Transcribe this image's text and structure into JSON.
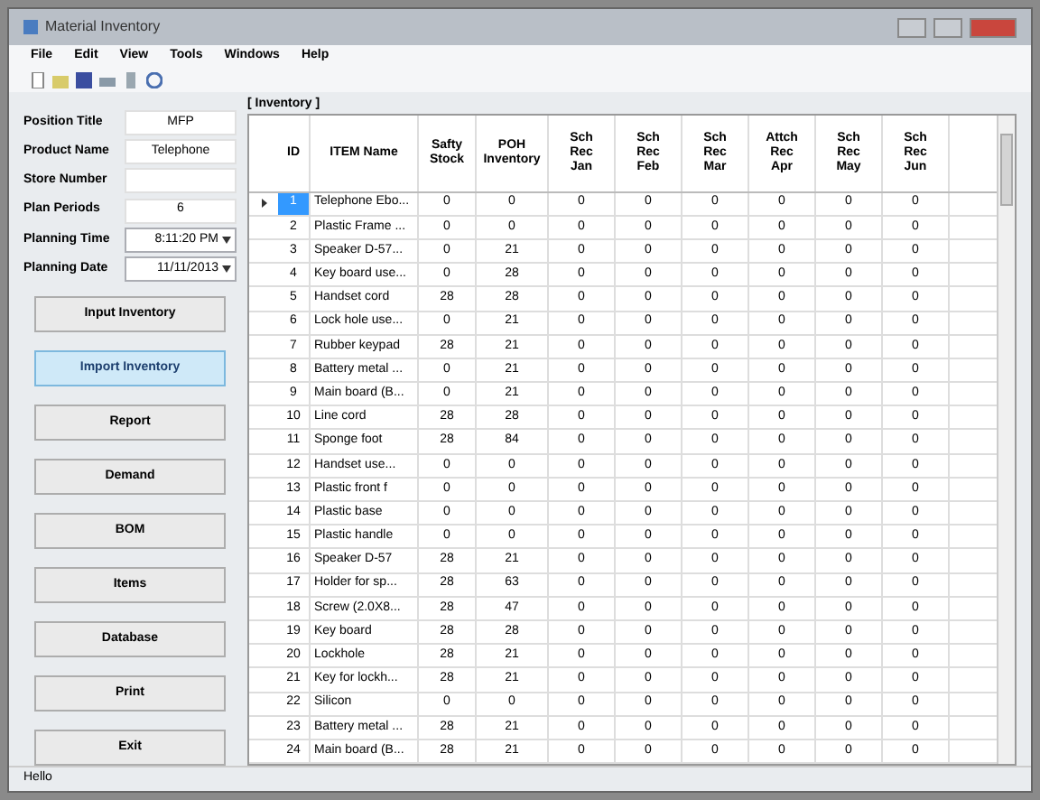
{
  "window": {
    "title": "Material Inventory"
  },
  "menu": [
    "File",
    "Edit",
    "View",
    "Tools",
    "Windows",
    "Help"
  ],
  "form": {
    "fields": [
      {
        "label": "Position Title",
        "value": "MFP",
        "kind": "text"
      },
      {
        "label": "Product Name",
        "value": "Telephone",
        "kind": "text"
      },
      {
        "label": "Store Number",
        "kind": "text"
      },
      {
        "label": "Plan Periods",
        "value": "6",
        "kind": "text"
      },
      {
        "label": "Planning Time",
        "value": "8:11:20 PM",
        "kind": "dropdown"
      },
      {
        "label": "Planning Date",
        "value": "11/11/2013",
        "kind": "dropdown"
      }
    ],
    "buttons": [
      {
        "label": "Input Inventory",
        "selected": false
      },
      {
        "label": "Import Inventory",
        "selected": true
      },
      {
        "label": "Report",
        "selected": false
      },
      {
        "label": "Demand",
        "selected": false
      },
      {
        "label": "BOM",
        "selected": false
      },
      {
        "label": "Items",
        "selected": false
      },
      {
        "label": "Database",
        "selected": false
      },
      {
        "label": "Print",
        "selected": false
      },
      {
        "label": "Exit",
        "selected": false
      }
    ]
  },
  "group_title": "[ Inventory ]",
  "table": {
    "columns": [
      "ID",
      "ITEM Name",
      "Safty Stock",
      "POH Inventory",
      "Sch Rec Jan",
      "Sch Rec Feb",
      "Sch Rec Mar",
      "Attch Rec Apr",
      "Sch Rec May",
      "Sch Rec Jun"
    ],
    "rows": [
      {
        "selected": true,
        "cells": [
          "1",
          "Telephone Ebo...",
          "0",
          "0",
          "0",
          "0",
          "0",
          "0",
          "0",
          "0"
        ]
      },
      {
        "selected": false,
        "cells": [
          "2",
          "Plastic Frame ...",
          "0",
          "0",
          "0",
          "0",
          "0",
          "0",
          "0",
          "0"
        ]
      },
      {
        "selected": false,
        "cells": [
          "3",
          "Speaker D-57...",
          "0",
          "21",
          "0",
          "0",
          "0",
          "0",
          "0",
          "0"
        ]
      },
      {
        "selected": false,
        "cells": [
          "4",
          "Key board use...",
          "0",
          "28",
          "0",
          "0",
          "0",
          "0",
          "0",
          "0"
        ]
      },
      {
        "selected": false,
        "cells": [
          "5",
          "Handset cord",
          "28",
          "28",
          "0",
          "0",
          "0",
          "0",
          "0",
          "0"
        ]
      },
      {
        "selected": false,
        "cells": [
          "6",
          "Lock hole use...",
          "0",
          "21",
          "0",
          "0",
          "0",
          "0",
          "0",
          "0"
        ]
      },
      {
        "selected": false,
        "cells": [
          "7",
          "Rubber keypad",
          "28",
          "21",
          "0",
          "0",
          "0",
          "0",
          "0",
          "0"
        ]
      },
      {
        "selected": false,
        "cells": [
          "8",
          "Battery metal ...",
          "0",
          "21",
          "0",
          "0",
          "0",
          "0",
          "0",
          "0"
        ]
      },
      {
        "selected": false,
        "cells": [
          "9",
          "Main board (B...",
          "0",
          "21",
          "0",
          "0",
          "0",
          "0",
          "0",
          "0"
        ]
      },
      {
        "selected": false,
        "cells": [
          "10",
          "Line cord",
          "28",
          "28",
          "0",
          "0",
          "0",
          "0",
          "0",
          "0"
        ]
      },
      {
        "selected": false,
        "cells": [
          "11",
          "Sponge foot",
          "28",
          "84",
          "0",
          "0",
          "0",
          "0",
          "0",
          "0"
        ]
      },
      {
        "selected": false,
        "cells": [
          "12",
          "Handset use...",
          "0",
          "0",
          "0",
          "0",
          "0",
          "0",
          "0",
          "0"
        ]
      },
      {
        "selected": false,
        "cells": [
          "13",
          "Plastic front f",
          "0",
          "0",
          "0",
          "0",
          "0",
          "0",
          "0",
          "0"
        ]
      },
      {
        "selected": false,
        "cells": [
          "14",
          "Plastic base",
          "0",
          "0",
          "0",
          "0",
          "0",
          "0",
          "0",
          "0"
        ]
      },
      {
        "selected": false,
        "cells": [
          "15",
          "Plastic handle",
          "0",
          "0",
          "0",
          "0",
          "0",
          "0",
          "0",
          "0"
        ]
      },
      {
        "selected": false,
        "cells": [
          "16",
          "Speaker D-57",
          "28",
          "21",
          "0",
          "0",
          "0",
          "0",
          "0",
          "0"
        ]
      },
      {
        "selected": false,
        "cells": [
          "17",
          "Holder for sp...",
          "28",
          "63",
          "0",
          "0",
          "0",
          "0",
          "0",
          "0"
        ]
      },
      {
        "selected": false,
        "cells": [
          "18",
          "Screw (2.0X8...",
          "28",
          "47",
          "0",
          "0",
          "0",
          "0",
          "0",
          "0"
        ]
      },
      {
        "selected": false,
        "cells": [
          "19",
          "Key board",
          "28",
          "28",
          "0",
          "0",
          "0",
          "0",
          "0",
          "0"
        ]
      },
      {
        "selected": false,
        "cells": [
          "20",
          "Lockhole",
          "28",
          "21",
          "0",
          "0",
          "0",
          "0",
          "0",
          "0"
        ]
      },
      {
        "selected": false,
        "cells": [
          "21",
          "Key for lockh...",
          "28",
          "21",
          "0",
          "0",
          "0",
          "0",
          "0",
          "0"
        ]
      },
      {
        "selected": false,
        "cells": [
          "22",
          "Silicon",
          "0",
          "0",
          "0",
          "0",
          "0",
          "0",
          "0",
          "0"
        ]
      },
      {
        "selected": false,
        "cells": [
          "23",
          "Battery metal ...",
          "28",
          "21",
          "0",
          "0",
          "0",
          "0",
          "0",
          "0"
        ]
      },
      {
        "selected": false,
        "cells": [
          "24",
          "Main board (B...",
          "28",
          "21",
          "0",
          "0",
          "0",
          "0",
          "0",
          "0"
        ]
      }
    ]
  },
  "status_bar": "Hello"
}
